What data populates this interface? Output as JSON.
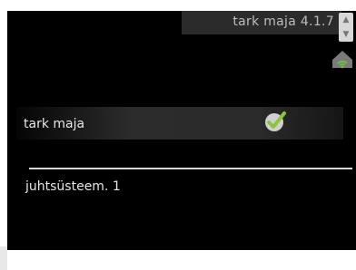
{
  "header": {
    "title": "tark maja 4.1.7"
  },
  "icons": {
    "scroll": "scroll-arrows-icon",
    "home": "smart-home-wifi-icon",
    "check": "checkmark-icon"
  },
  "menu": {
    "items": [
      {
        "label": "tark maja",
        "checked": true
      },
      {
        "label": "juhtsüsteem. 1"
      }
    ]
  },
  "colors": {
    "background": "#000000",
    "checkmark": "#8bc53f",
    "text": "#e6e6e6",
    "title": "#bdbdbd"
  }
}
